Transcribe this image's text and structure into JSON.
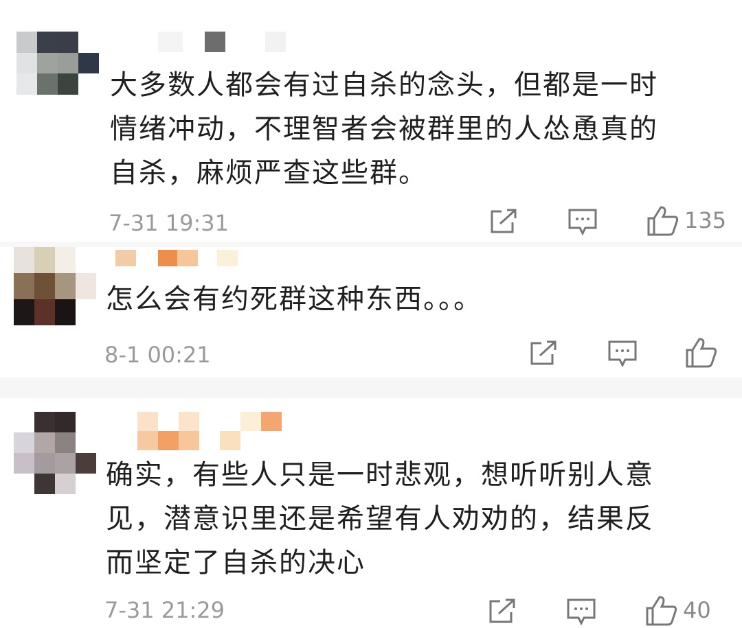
{
  "comments": [
    {
      "text": "大多数人都会有过自杀的念头，但都是一时\n情绪冲动，不理智者会被群里的人怂恿真的\n自杀，麻烦严查这些群。",
      "time": "7-31 19:31",
      "likes": "135"
    },
    {
      "text": "怎么会有约死群这种东西。。。",
      "time": "8-1 00:21",
      "likes": ""
    },
    {
      "text": "确实，有些人只是一时悲观，想听听别人意\n见，潜意识里还是希望有人劝劝的，结果反\n而坚定了自杀的决心",
      "time": "7-31 21:29",
      "likes": "40"
    }
  ],
  "icons": {
    "share": "share-icon",
    "comment": "comment-icon",
    "like": "thumbs-up-icon"
  },
  "colors": {
    "text": "#1f1f1f",
    "meta": "#9a9a9a",
    "icon": "#777777"
  }
}
